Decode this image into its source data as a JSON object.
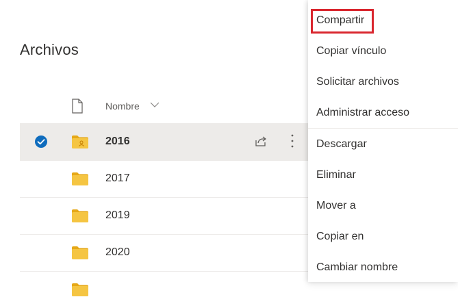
{
  "page": {
    "title": "Archivos"
  },
  "list": {
    "header": {
      "name_column": "Nombre"
    },
    "rows": [
      {
        "name": "2016",
        "selected": true,
        "folder_type": "shared"
      },
      {
        "name": "2017",
        "selected": false,
        "folder_type": "plain"
      },
      {
        "name": "2019",
        "selected": false,
        "folder_type": "plain"
      },
      {
        "name": "2020",
        "selected": false,
        "folder_type": "plain"
      }
    ]
  },
  "context_menu": {
    "items": [
      "Compartir",
      "Copiar vínculo",
      "Solicitar archivos",
      "Administrar acceso",
      "Descargar",
      "Eliminar",
      "Mover a",
      "Copiar en",
      "Cambiar nombre"
    ],
    "highlighted_item": "Compartir"
  },
  "icons": {
    "file_type": "file-icon",
    "sort": "chevron-down-icon",
    "selected": "check-circle-icon",
    "folder": "folder-icon",
    "shared_folder": "shared-folder-icon",
    "share": "share-icon",
    "more": "more-vertical-icon"
  },
  "colors": {
    "accent": "#0f6cbd",
    "folder": "#f5c542",
    "folder_dark": "#e6a817",
    "selected_row": "#edebe9",
    "highlight_border": "#d9262e",
    "text": "#323130"
  }
}
